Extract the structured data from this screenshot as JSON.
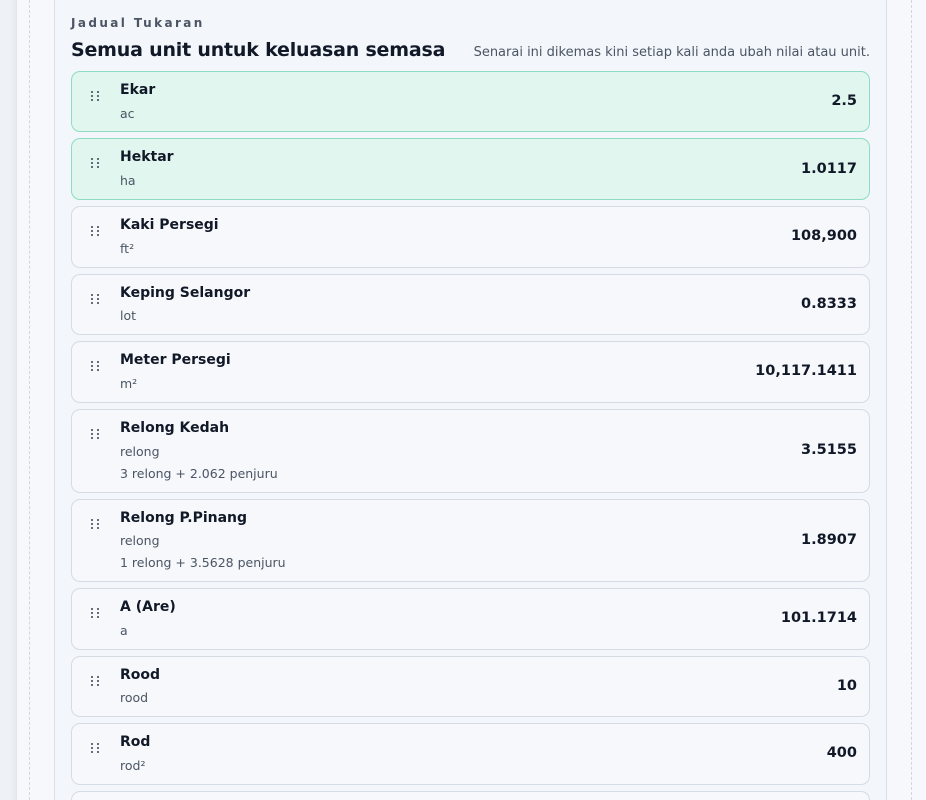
{
  "section": {
    "eyebrow": "Jadual Tukaran",
    "title": "Semua unit untuk keluasan semasa",
    "hint": "Senarai ini dikemas kini setiap kali anda ubah nilai atau unit."
  },
  "colors": {
    "highlight_bg": "#e1f6ef",
    "highlight_border": "#8fdcc2"
  },
  "units": [
    {
      "name": "Ekar",
      "symbol": "ac",
      "value": "2.5",
      "highlighted": true
    },
    {
      "name": "Hektar",
      "symbol": "ha",
      "value": "1.0117",
      "highlighted": true
    },
    {
      "name": "Kaki Persegi",
      "symbol": "ft²",
      "value": "108,900"
    },
    {
      "name": "Keping Selangor",
      "symbol": "lot",
      "value": "0.8333"
    },
    {
      "name": "Meter Persegi",
      "symbol": "m²",
      "value": "10,117.1411"
    },
    {
      "name": "Relong Kedah",
      "symbol": "relong",
      "note": "3 relong + 2.062 penjuru",
      "value": "3.5155"
    },
    {
      "name": "Relong P.Pinang",
      "symbol": "relong",
      "note": "1 relong + 3.5628 penjuru",
      "value": "1.8907"
    },
    {
      "name": "A (Are)",
      "symbol": "a",
      "value": "101.1714"
    },
    {
      "name": "Rood",
      "symbol": "rood",
      "value": "10"
    },
    {
      "name": "Rod",
      "symbol": "rod²",
      "value": "400"
    }
  ]
}
